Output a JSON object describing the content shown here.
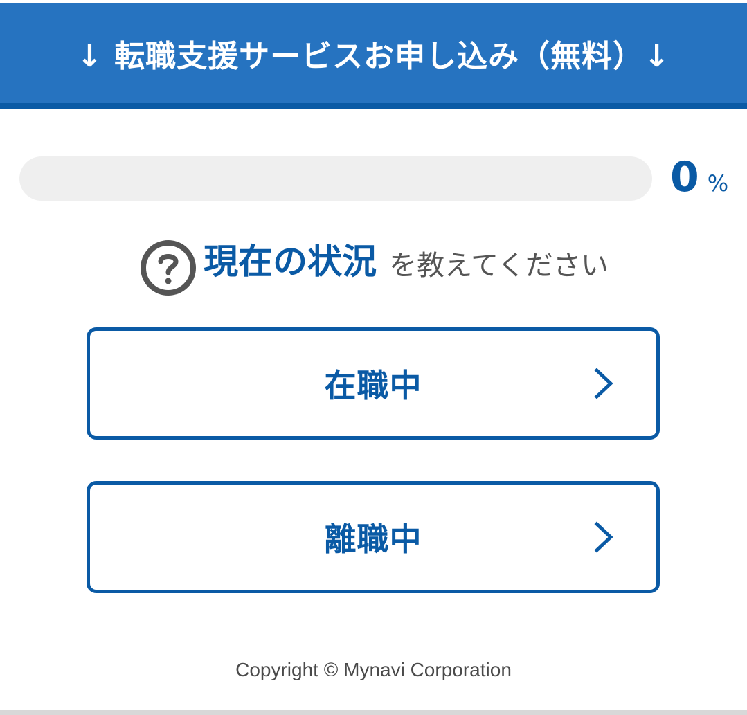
{
  "header": {
    "title": "↓ 転職支援サービスお申し込み（無料）↓"
  },
  "progress": {
    "value": "0",
    "unit": "%",
    "percent": 0
  },
  "question": {
    "icon": "question-circle-icon",
    "strong": "現在の状況",
    "rest": "を教えてください"
  },
  "options": [
    {
      "label": "在職中",
      "icon": "chevron-right-icon"
    },
    {
      "label": "離職中",
      "icon": "chevron-right-icon"
    }
  ],
  "footer": {
    "copyright": "Copyright © Mynavi Corporation"
  },
  "colors": {
    "header_bg": "#2673c0",
    "accent": "#0a5aa5",
    "progress_track": "#efefef",
    "question_text": "#555555",
    "footer_text": "#4a4a4a"
  }
}
